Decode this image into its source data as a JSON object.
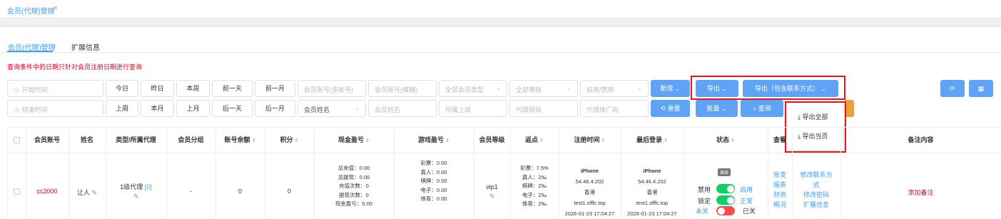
{
  "tab": {
    "title": "会员(代理)管理",
    "close": "×"
  },
  "subtabs": [
    "会员(代理)管理",
    "扩展信息"
  ],
  "notice": "查询条件中的日期只针对会员注册日期进行查询",
  "filters": {
    "start_time": "开始时间",
    "end_time": "结束时间",
    "today": "今日",
    "yesterday": "昨日",
    "this_week": "本周",
    "prev_day": "前一天",
    "prev_month": "前一月",
    "last_week": "上周",
    "this_month": "本月",
    "last_month": "上月",
    "next_day": "后一天",
    "next_month2": "后一月",
    "acct_multi": "会员账号(多账号)",
    "acct_fuzzy": "会员账号(模糊)",
    "all_types": "全部会员类型",
    "all_levels": "全部等级",
    "enable_disable": "启用/禁用",
    "name_select": "会员姓名",
    "member_name": "会员姓名",
    "superior": "所属上级",
    "agent_level": "代理层级",
    "agent_code": "代理推广码"
  },
  "actions": {
    "add": "新增",
    "export": "导出",
    "export_contact": "导出（包含联系方式）",
    "reset": "重置",
    "batch": "批量",
    "query": "查询"
  },
  "export_menu": [
    "导出全部",
    "导出当页"
  ],
  "table": {
    "headers": [
      "会员账号",
      "姓名",
      "类型/所属代理",
      "会员分组",
      "账号余额",
      "积分",
      "现金盈亏",
      "游戏盈亏",
      "会员等级",
      "返点",
      "注册时间",
      "最后登录",
      "状态",
      "查看",
      "备注内容"
    ],
    "row": {
      "account": "cc2000",
      "name": "让人",
      "type": "1级代理",
      "type_link": "[0]",
      "group": "-",
      "balance": "0",
      "points": "0",
      "cash": [
        "总充值：0.00",
        "总提现：0.00",
        "充值次数：0",
        "提现次数：0",
        "现金盈亏：0.00"
      ],
      "game": [
        "彩票：0.00",
        "真人：0.00",
        "棋牌：0.00",
        "电子：0.00",
        "体育：0.00"
      ],
      "level": "vip1",
      "rebate": [
        "彩票：7.5%",
        "真人：2‰",
        "棋牌：2‰",
        "电子：2‰",
        "体育：2‰"
      ],
      "reg": [
        "iPhone",
        "54.46.4.202",
        "香港",
        "test1.sfffc.top",
        "2026-01-23 17:04:27"
      ],
      "login": [
        "iPhone",
        "54.46.4.202",
        "香港",
        "test1.sfffc.top",
        "2026-01-23 17:04:27"
      ],
      "status_badge": "离线",
      "status": [
        {
          "left": "禁用",
          "right": "启用",
          "on": true
        },
        {
          "left": "锁定",
          "right": "正常",
          "on": true
        },
        {
          "left": "未关",
          "right": "已关",
          "on": false
        }
      ],
      "view": [
        "账变",
        "报表",
        "财务",
        "概况"
      ],
      "ops": [
        "修改联系方",
        "式",
        "修改密码",
        "扩展信息"
      ],
      "note": "添加备注"
    }
  },
  "colors": {
    "accent": "#409eff",
    "primary_btn": "#5fa3f6",
    "danger": "#e0001f",
    "highlight": "#e8141d",
    "switch_on": "#13ce66",
    "switch_off": "#ff4949"
  }
}
